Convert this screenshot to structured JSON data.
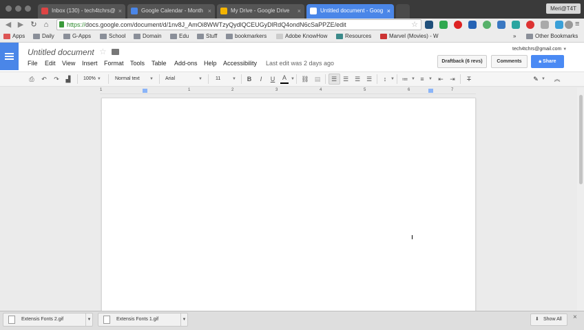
{
  "browser": {
    "tabs": [
      {
        "title": "Inbox (130) - tech4tchrs@"
      },
      {
        "title": "Google Calendar - Month"
      },
      {
        "title": "My Drive - Google Drive"
      },
      {
        "title": "Untitled document - Goog"
      }
    ],
    "profile": "Meri@T4T",
    "url_scheme": "https://",
    "url_rest": "docs.google.com/document/d/1nv8J_AmOi8WWTzyQydlQCEUGyDlRdQ4ondN6cSaPPZE/edit",
    "bookmarks": [
      "Apps",
      "Daily",
      "G-Apps",
      "School",
      "Domain",
      "Edu",
      "Stuff",
      "bookmarkers",
      "Adobe KnowHow",
      "Resources",
      "Marvel (Movies) - W"
    ],
    "bookmarks_overflow": "»",
    "other_bookmarks": "Other Bookmarks"
  },
  "doc": {
    "title": "Untitled document",
    "account": "tech4tchrs@gmail.com",
    "menus": [
      "File",
      "Edit",
      "View",
      "Insert",
      "Format",
      "Tools",
      "Table",
      "Add-ons",
      "Help",
      "Accessibility"
    ],
    "last_edit": "Last edit was 2 days ago",
    "draftback": "Draftback (6 revs)",
    "comments": "Comments",
    "share": "Share"
  },
  "toolbar": {
    "zoom": "100%",
    "style": "Normal text",
    "font": "Arial",
    "size": "11",
    "bold": "B",
    "italic": "I",
    "underline": "U",
    "text_color": "A"
  },
  "ruler": [
    "1",
    "1",
    "2",
    "3",
    "4",
    "5",
    "6",
    "7"
  ],
  "downloads": {
    "items": [
      "Extensis Fonts 2.gif",
      "Extensis Fonts 1.gif"
    ],
    "show_all": "Show All",
    "close": "×"
  },
  "colors": {
    "docs_blue": "#4a86e8",
    "share_blue": "#4a8af4",
    "https_green": "#2e8b2e"
  }
}
